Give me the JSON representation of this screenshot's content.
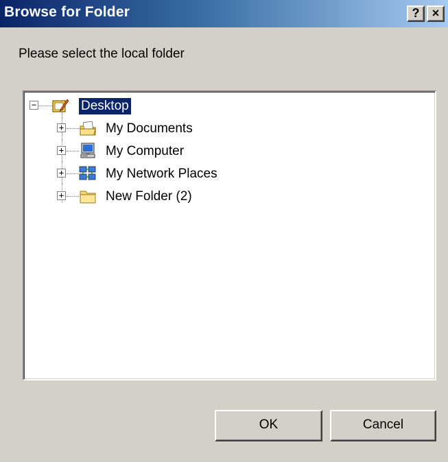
{
  "window": {
    "title": "Browse for Folder",
    "help_label": "?",
    "close_label": "×"
  },
  "prompt": "Please select the local folder",
  "tree": {
    "root": {
      "label": "Desktop",
      "expander": "−",
      "icon": "desktop-icon",
      "selected": true
    },
    "children": [
      {
        "label": "My Documents",
        "expander": "+",
        "icon": "my-documents-icon"
      },
      {
        "label": "My Computer",
        "expander": "+",
        "icon": "my-computer-icon"
      },
      {
        "label": "My Network Places",
        "expander": "+",
        "icon": "network-places-icon"
      },
      {
        "label": "New Folder (2)",
        "expander": "+",
        "icon": "folder-icon"
      }
    ]
  },
  "buttons": {
    "ok": "OK",
    "cancel": "Cancel"
  },
  "colors": {
    "face": "#d4d0c8",
    "title_start": "#0a246a",
    "title_end": "#a6caf0",
    "selection": "#0a246a"
  }
}
